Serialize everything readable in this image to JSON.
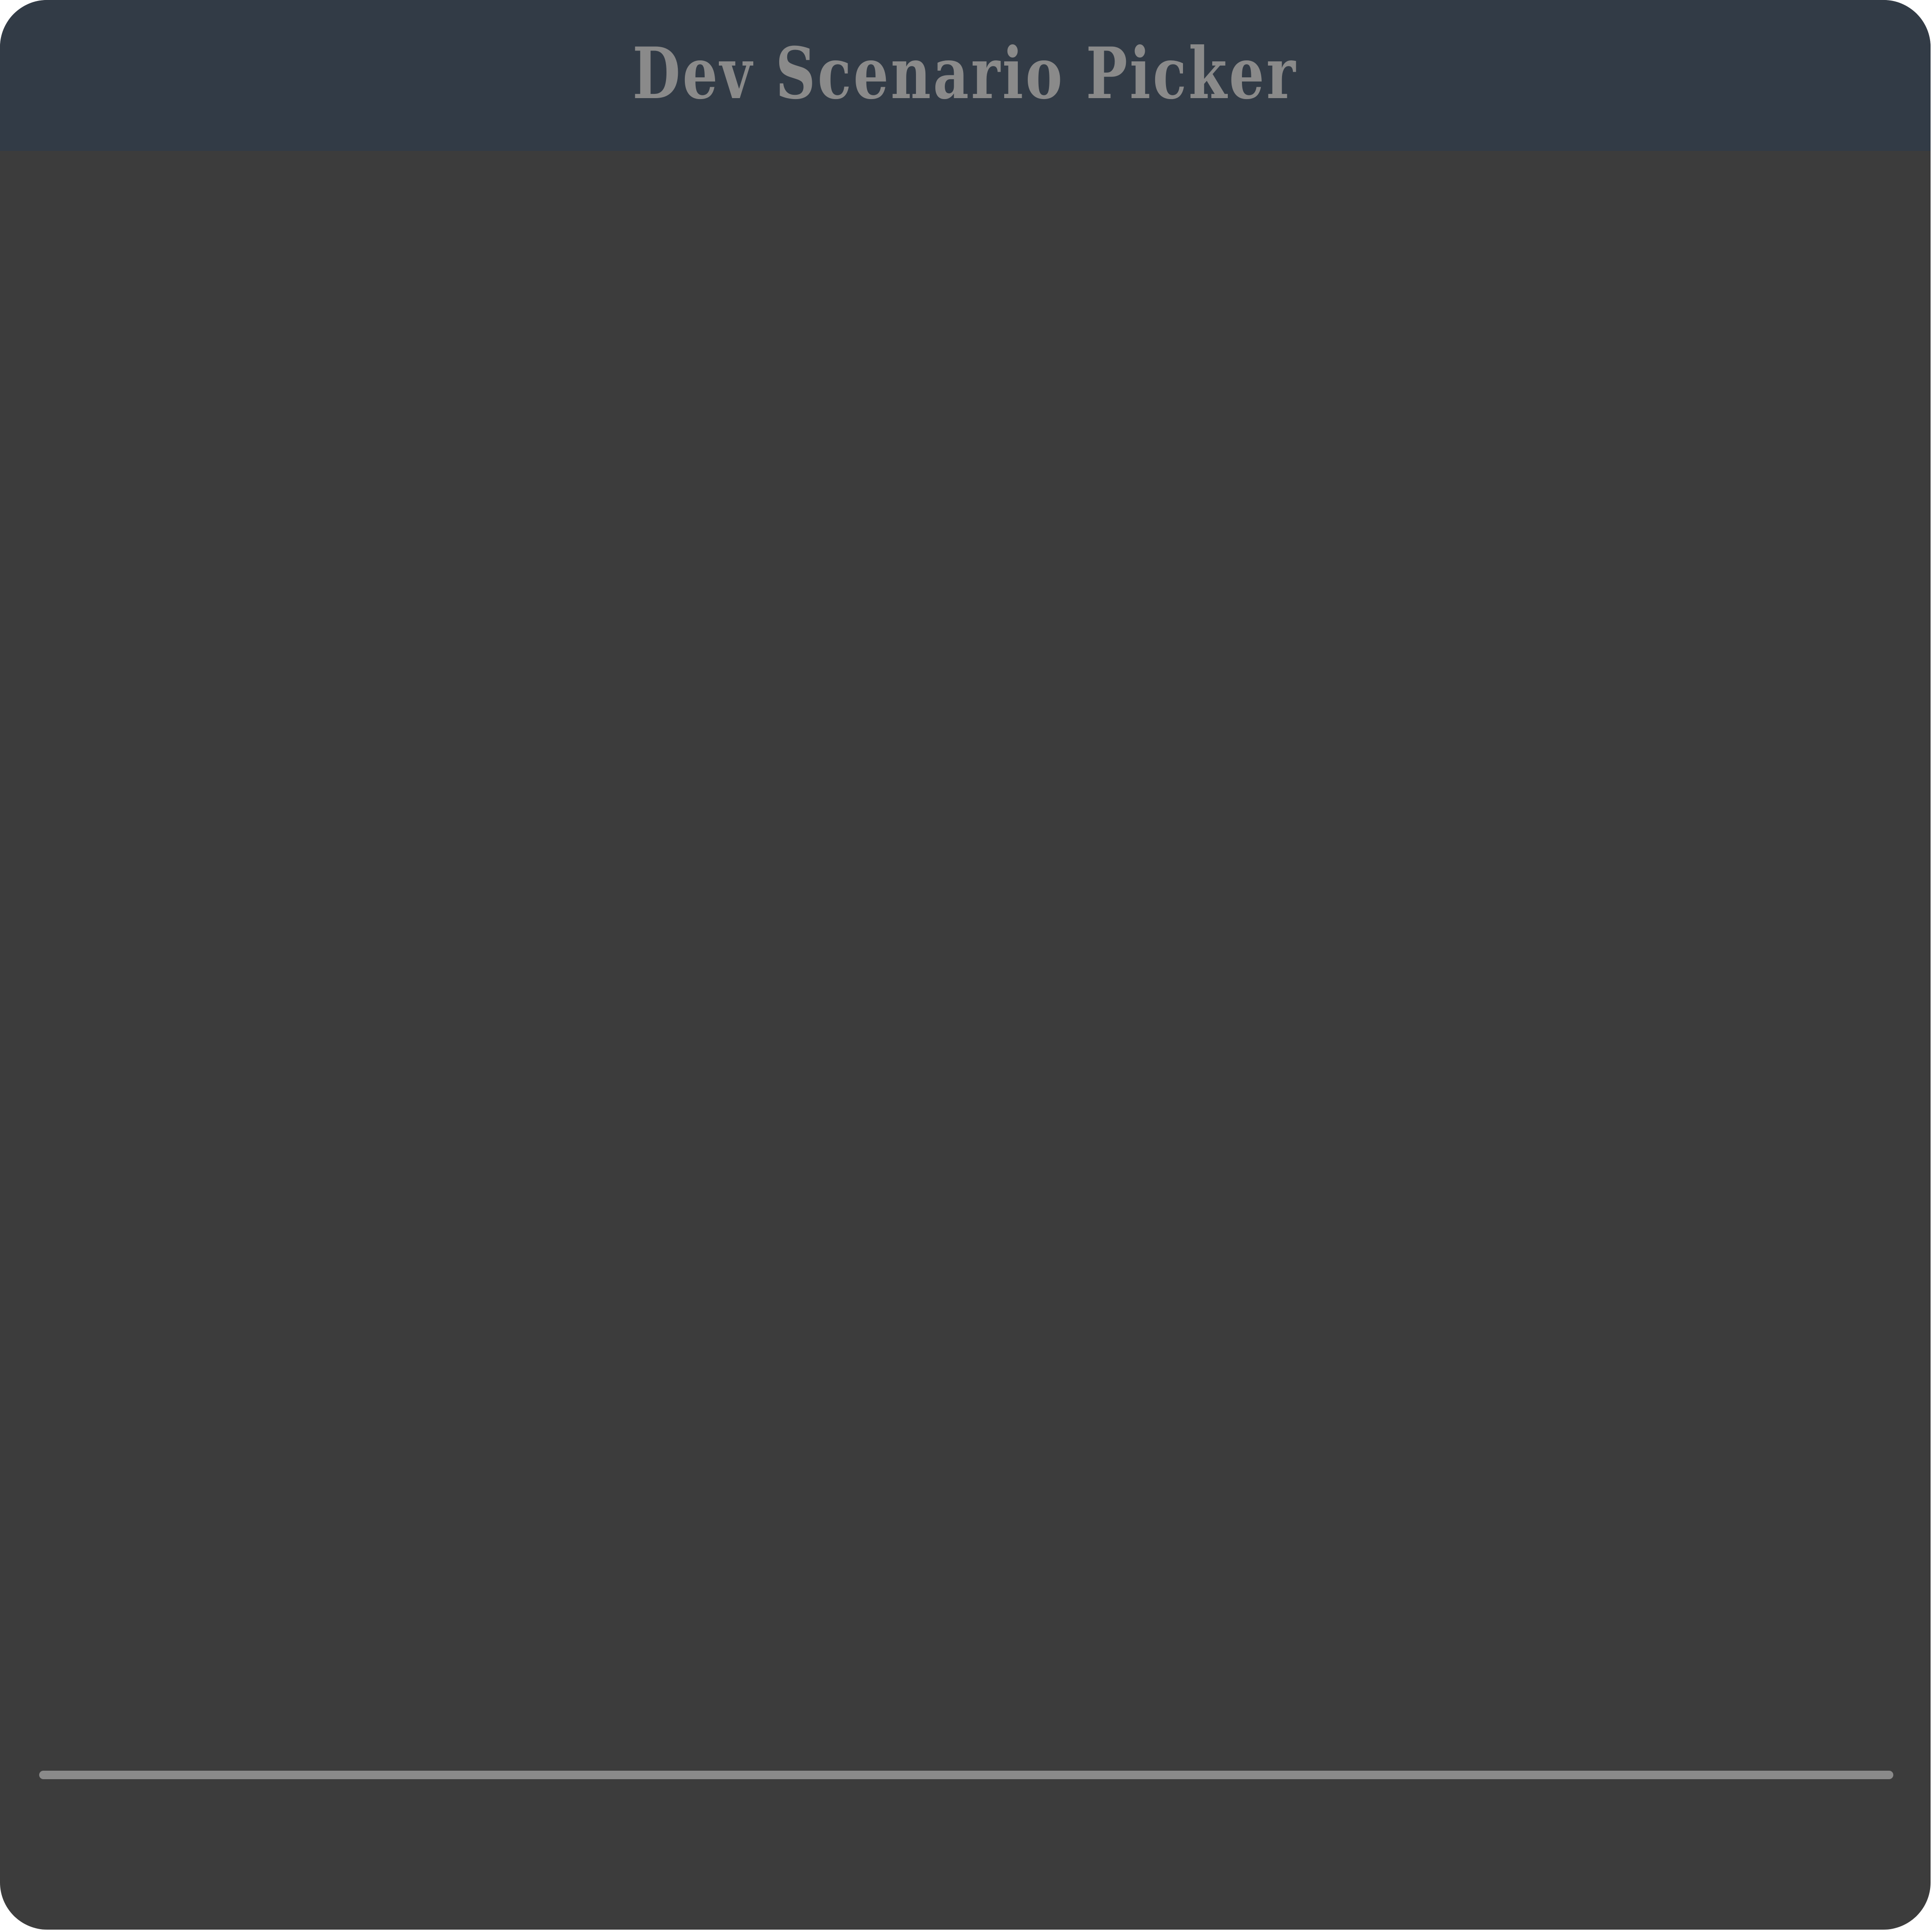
{
  "window": {
    "title": "Dev Scenario Picker"
  },
  "colors": {
    "title_bar_bg": "#323b46",
    "window_bg": "#3c3c3c",
    "title_text": "#8a8a8a",
    "progress_fill": "#8a8a8a"
  },
  "progress": {
    "fraction": 1.0
  }
}
